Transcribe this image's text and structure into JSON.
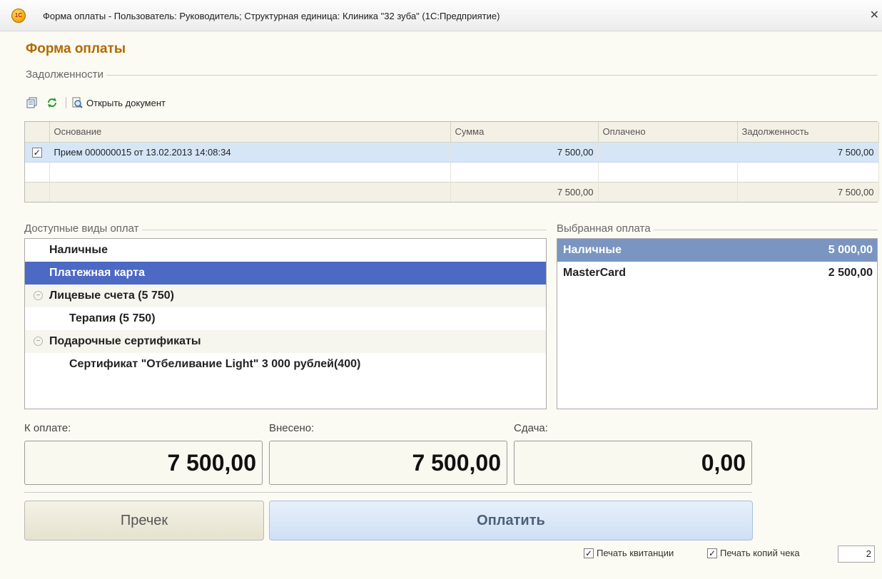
{
  "window": {
    "app_logo": "1С",
    "title": "Форма оплаты - Пользователь: Руководитель;  Структурная единица: Клиника \"32 зуба\"  (1С:Предприятие)",
    "close": "✕"
  },
  "form_title": "Форма оплаты",
  "debts": {
    "group_label": "Задолженности",
    "toolbar": {
      "open_doc_label": "Открыть документ"
    },
    "columns": [
      "Основание",
      "Сумма",
      "Оплачено",
      "Задолженность"
    ],
    "rows": [
      {
        "checked": "✓",
        "basis": "Прием 000000015 от 13.02.2013 14:08:34",
        "sum": "7 500,00",
        "paid": "",
        "debt": "7 500,00"
      }
    ],
    "totals": {
      "sum": "7 500,00",
      "paid": "",
      "debt": "7 500,00"
    }
  },
  "available": {
    "group_label": "Доступные виды оплат",
    "items": [
      {
        "label": "Наличные"
      },
      {
        "label": "Платежная карта"
      },
      {
        "label": "Лицевые счета (5 750)",
        "toggle": "−"
      },
      {
        "label": "Терапия (5 750)"
      },
      {
        "label": "Подарочные сертификаты",
        "toggle": "−"
      },
      {
        "label": "Сертификат \"Отбеливание Light\" 3 000 рублей(400)"
      }
    ]
  },
  "selected": {
    "group_label": "Выбранная оплата",
    "items": [
      {
        "label": "Наличные",
        "amount": "5 000,00"
      },
      {
        "label": "MasterCard",
        "amount": "2 500,00"
      }
    ]
  },
  "totals": {
    "to_pay_label": "К оплате:",
    "to_pay": "7 500,00",
    "paid_in_label": "Внесено:",
    "paid_in": "7 500,00",
    "change_label": "Сдача:",
    "change": "0,00"
  },
  "buttons": {
    "precheck": "Пречек",
    "pay": "Оплатить"
  },
  "options": {
    "print_receipt_label": "Печать квитанции",
    "print_receipt_check": "✓",
    "print_copies_label": "Печать копий чека",
    "print_copies_check": "✓",
    "copies_count": "2"
  }
}
